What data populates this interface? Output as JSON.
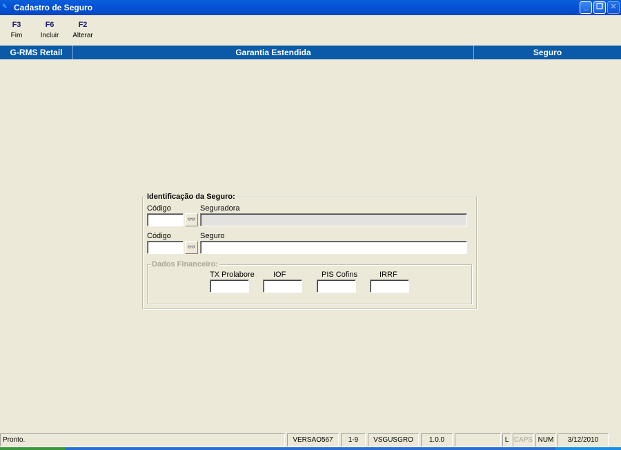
{
  "window": {
    "title": "Cadastro de Seguro",
    "app_icon": "rms-logo-icon"
  },
  "toolbar": [
    {
      "key": "F3",
      "label": "Fim"
    },
    {
      "key": "F6",
      "label": "Incluir"
    },
    {
      "key": "F2",
      "label": "Alterar"
    }
  ],
  "band": {
    "left": "G-RMS Retail",
    "center": "Garantia Estendida",
    "right": "Seguro"
  },
  "form": {
    "group_title": "Identificação da Seguro:",
    "codigo1_label": "Código",
    "seguradora_label": "Seguradora",
    "codigo2_label": "Código",
    "seguro_label": "Seguro",
    "codigo1_value": "",
    "seguradora_value": "",
    "codigo2_value": "",
    "seguro_value": "",
    "financeiro": {
      "title": "Dados Financeiro:",
      "fields": [
        {
          "label": "TX Prolabore",
          "value": ""
        },
        {
          "label": "IOF",
          "value": ""
        },
        {
          "label": "PIS Cofins",
          "value": ""
        },
        {
          "label": "IRRF",
          "value": ""
        }
      ]
    }
  },
  "status": {
    "message": "Pronto.",
    "panels": [
      "VERSAO567",
      "1-9",
      "VSGUSGRO",
      "1.0.0",
      "",
      "L",
      "CAPS",
      "NUM",
      "3/12/2010"
    ]
  }
}
